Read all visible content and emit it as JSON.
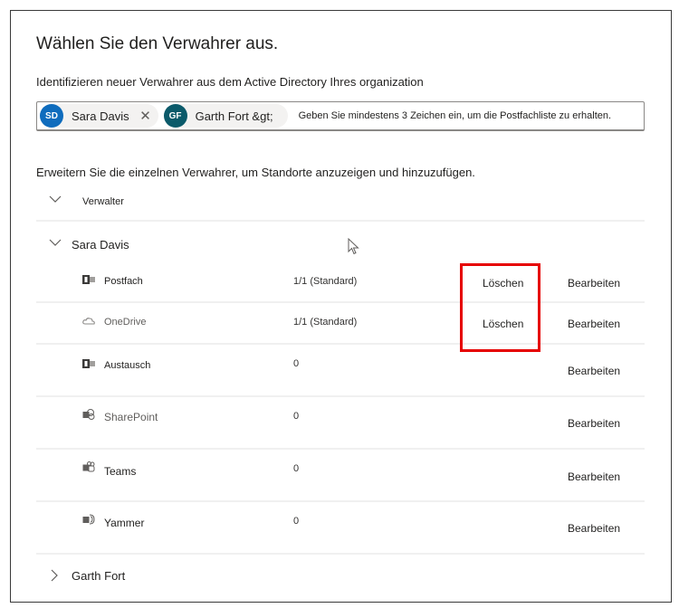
{
  "dialog": {
    "title": "Wählen Sie den Verwahrer aus.",
    "subtitle": "Identifizieren neuer Verwahrer aus dem Active Directory Ihres organization"
  },
  "picker": {
    "chips": [
      {
        "initials": "SD",
        "name": "Sara Davis",
        "avatar_color": "#0f6cbd",
        "removable": true
      },
      {
        "initials": "GF",
        "name": "Garth Fort &gt;",
        "avatar_color": "#0b5a6a",
        "removable": false
      }
    ],
    "placeholder": "Geben Sie mindestens 3 Zeichen ein, um die Postfachliste zu erhalten."
  },
  "instructions": "Erweitern Sie die einzelnen Verwahrer, um Standorte anzuzeigen und hinzuzufügen.",
  "list": {
    "column_header": "Verwalter",
    "groups": [
      {
        "name": "Sara Davis",
        "expanded": true,
        "locations": [
          {
            "icon": "exchange-icon",
            "name": "Postfach",
            "count": "1/1 (Standard)",
            "delete_label": "Löschen",
            "edit_label": "Bearbeiten"
          },
          {
            "icon": "onedrive-icon",
            "name": "OneDrive",
            "count": "1/1 (Standard)",
            "delete_label": "Löschen",
            "edit_label": "Bearbeiten"
          },
          {
            "icon": "exchange-icon",
            "name": "Austausch",
            "count": "0",
            "delete_label": "",
            "edit_label": "Bearbeiten"
          },
          {
            "icon": "sharepoint-icon",
            "name": "SharePoint",
            "count": "0",
            "delete_label": "",
            "edit_label": "Bearbeiten"
          },
          {
            "icon": "teams-icon",
            "name": "Teams",
            "count": "0",
            "delete_label": "",
            "edit_label": "Bearbeiten"
          },
          {
            "icon": "yammer-icon",
            "name": "Yammer",
            "count": "0",
            "delete_label": "",
            "edit_label": "Bearbeiten"
          }
        ]
      },
      {
        "name": "Garth Fort",
        "expanded": false
      }
    ]
  },
  "annotation": {
    "highlight_color": "#e60000"
  }
}
